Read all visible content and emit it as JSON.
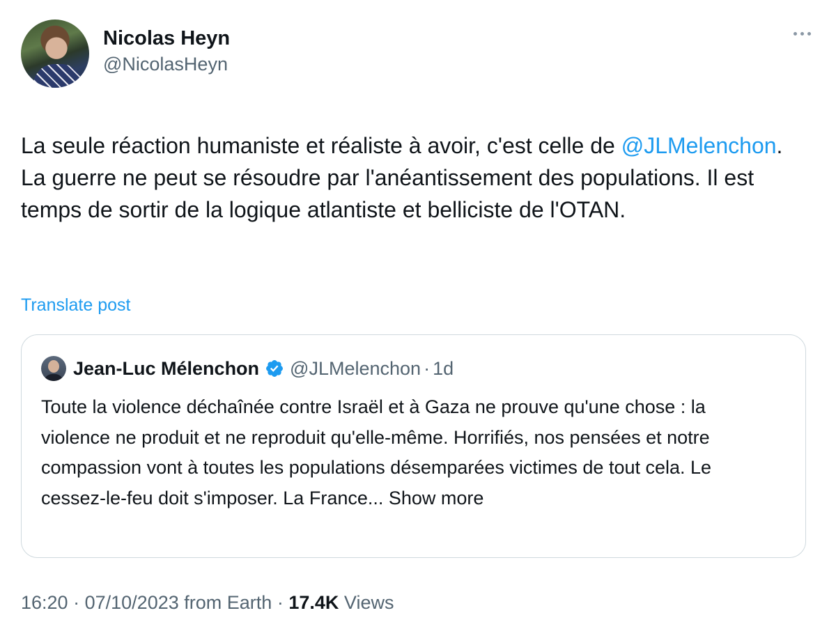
{
  "author": {
    "display_name": "Nicolas Heyn",
    "handle": "@NicolasHeyn"
  },
  "tweet": {
    "text_part1": "La seule réaction humaniste et réaliste à avoir, c'est celle de ",
    "mention": "@JLMelenchon",
    "text_part2": ". La guerre ne peut se résoudre par l'anéantissement des populations. Il est temps de sortir de la logique atlantiste et belliciste de l'OTAN."
  },
  "translate_label": "Translate post",
  "quoted": {
    "display_name": "Jean-Luc Mélenchon",
    "handle": "@JLMelenchon",
    "separator": "·",
    "time": "1d",
    "text": "Toute la violence déchaînée contre Israël et à Gaza ne prouve qu'une chose : la violence ne produit et ne reproduit qu'elle-même. Horrifiés, nos pensées et notre compassion vont à toutes les populations désemparées victimes de tout cela. Le cessez-le-feu doit s'imposer. La France... Show more"
  },
  "meta": {
    "time": "16:20",
    "sep1": "·",
    "date": "07/10/2023",
    "source": "from Earth",
    "sep2": "·",
    "views_count": "17.4K",
    "views_label": "Views"
  },
  "colors": {
    "link": "#1d9bf0",
    "secondary": "#536471",
    "border": "#cfd9de"
  },
  "icons": {
    "more": "more-dots-icon",
    "verified": "verified-badge-icon"
  }
}
